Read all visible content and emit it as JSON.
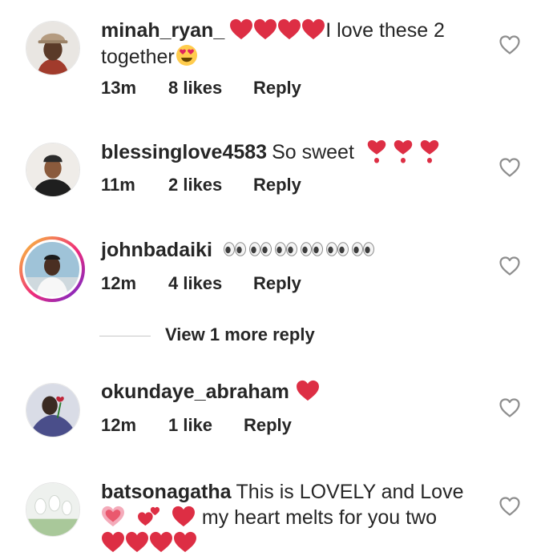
{
  "comments": [
    {
      "username": "minah_ryan_",
      "text_after_hearts": "I love these 2 together",
      "time": "13m",
      "likes": "8 likes",
      "reply": "Reply"
    },
    {
      "username": "blessinglove4583",
      "text": "So sweet",
      "time": "11m",
      "likes": "2 likes",
      "reply": "Reply"
    },
    {
      "username": "johnbadaiki",
      "time": "12m",
      "likes": "4 likes",
      "reply": "Reply"
    },
    {
      "username": "okundaye_abraham",
      "time": "12m",
      "likes": "1 like",
      "reply": "Reply"
    },
    {
      "username": "batsonagatha",
      "text": "This is LOVELY and Love",
      "text_line2": "my heart melts for you two"
    }
  ],
  "view_replies": "View 1 more reply",
  "colors": {
    "text": "#262626",
    "heart_red": "#e0245e",
    "emoji_red": "#dd2e44",
    "outline_heart": "#8e8e8e",
    "story_ring": "#ee2a7b"
  },
  "icons": {
    "like": "heart-outline-icon",
    "emoji_heart": "red-heart-emoji",
    "emoji_exclamation_heart": "heart-exclamation-emoji",
    "emoji_eyes": "eyes-emoji",
    "emoji_heart_eyes": "heart-eyes-emoji",
    "emoji_sparkling_heart": "sparkling-heart-emoji",
    "emoji_two_hearts": "two-hearts-emoji"
  }
}
